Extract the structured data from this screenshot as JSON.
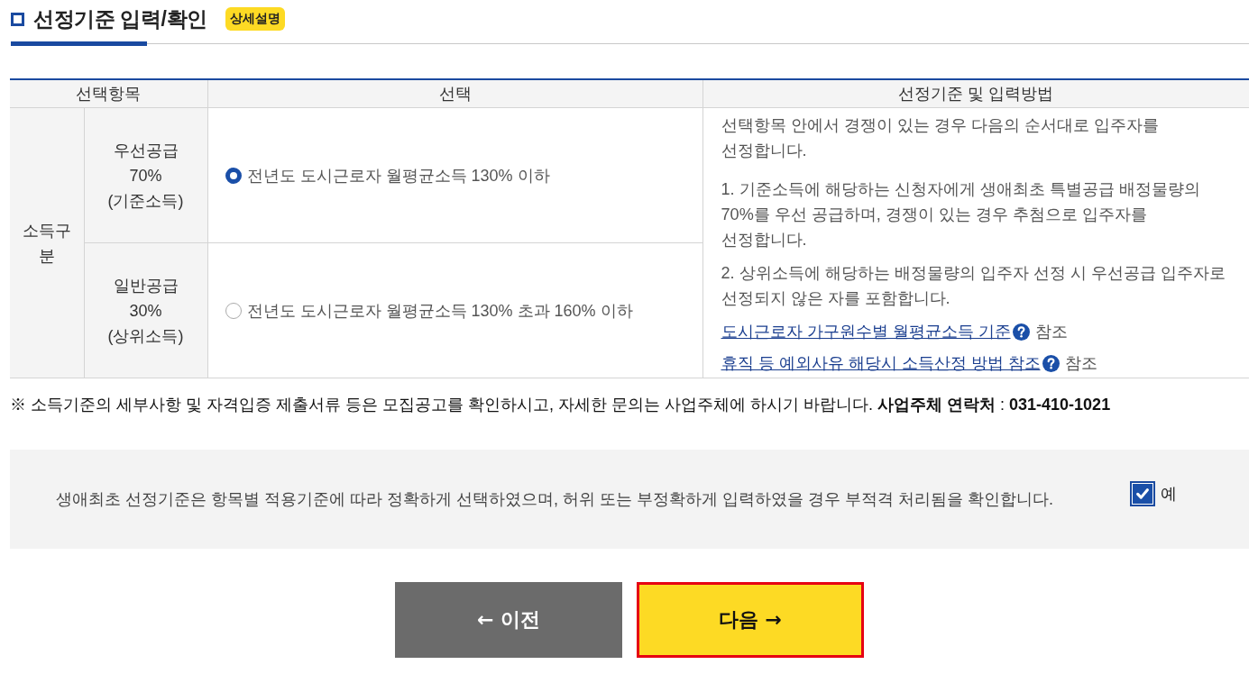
{
  "section": {
    "title": "선정기준 입력/확인",
    "badge": "상세설명"
  },
  "table": {
    "columns": [
      "선택항목",
      "선택",
      "선정기준 및 입력방법"
    ],
    "group": "소득구분",
    "rows": [
      {
        "item": "우선공급\n70%\n(기준소득)",
        "option": {
          "label": "전년도 도시근로자 월평균소득 130% 이하",
          "selected": true
        }
      },
      {
        "item": "일반공급\n30%\n(상위소득)",
        "option": {
          "label": "전년도 도시근로자 월평균소득 130% 초과 160% 이하",
          "selected": false
        }
      }
    ],
    "guide": {
      "paragraphs": [
        "선택항목 안에서 경쟁이 있는 경우 다음의 순서대로 입주자를 선정합니다.",
        "1. 기준소득에 해당하는 신청자에게 생애최초 특별공급 배정물량의 70%를 우선 공급하며, 경쟁이 있는 경우 추첨으로 입주자를 선정합니다.",
        "2. 상위소득에 해당하는 배정물량의 입주자 선정 시 우선공급 입주자로 선정되지 않은 자를 포함합니다."
      ],
      "links": [
        {
          "text": "도시근로자 가구원수별 월평균소득 기준",
          "suffix": "참조"
        },
        {
          "text": "휴직 등 예외사유 해당시 소득산정 방법 참조",
          "suffix": "참조"
        }
      ]
    }
  },
  "notice": "※ 소득기준의 세부사항 및 자격입증 제출서류 등은 모집공고를 확인하시고, 자세한 문의는 사업주체에 하시기 바랍니다. **사업주체 연락처** : **031-410-1021**",
  "confirm": {
    "text": "생애최초 선정기준은 항목별 적용기준에 따라 정확하게 선택하였으며, 허위 또는 부정확하게 입력하였을 경우 부적격 처리됨을 확인합니다.",
    "checked": true,
    "label": "예"
  },
  "buttons": [
    {
      "kind": "prev",
      "label": "← 이전",
      "focused": false
    },
    {
      "kind": "next",
      "label": "다음 →",
      "focused": true
    }
  ]
}
